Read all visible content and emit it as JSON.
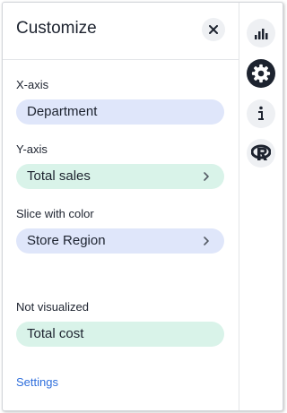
{
  "header": {
    "title": "Customize",
    "close_icon": "close-icon"
  },
  "x_axis": {
    "label": "X-axis",
    "value": "Department",
    "color": "#dfe6fa"
  },
  "y_axis": {
    "label": "Y-axis",
    "value": "Total sales",
    "color": "#d9f3e9"
  },
  "slice_with_color": {
    "label": "Slice with color",
    "value": "Store Region",
    "color": "#dfe6fa"
  },
  "not_visualized": {
    "label": "Not visualized",
    "value": "Total cost",
    "color": "#d9f3e9"
  },
  "footer": {
    "settings_link": "Settings"
  },
  "rail": [
    {
      "icon": "bar-chart-icon",
      "active": false
    },
    {
      "icon": "gear-icon",
      "active": true
    },
    {
      "icon": "info-icon",
      "active": false
    },
    {
      "icon": "r-logo-icon",
      "active": false
    }
  ],
  "colors": {
    "link": "#2f6fdc",
    "active_rail": "#1d232f"
  }
}
